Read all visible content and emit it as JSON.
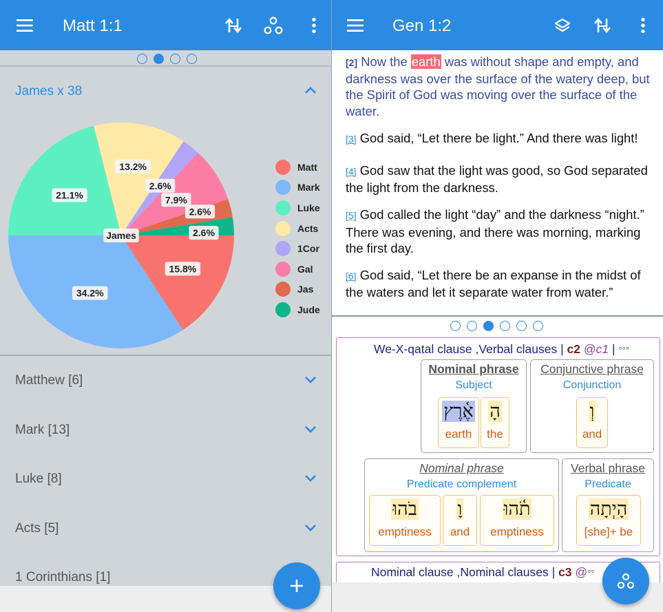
{
  "left": {
    "title": "Matt 1:1",
    "pager_dots": 4,
    "pager_active": 1,
    "card_heading": "James x 38",
    "center_label": "James",
    "books": [
      {
        "label": "Matthew [6]"
      },
      {
        "label": "Mark [13]"
      },
      {
        "label": "Luke [8]"
      },
      {
        "label": "Acts [5]"
      },
      {
        "label": "1 Corinthians [1]"
      }
    ]
  },
  "chart_data": {
    "type": "pie",
    "title": "",
    "center_label": "James",
    "categories": [
      "Matt",
      "Mark",
      "Luke",
      "Acts",
      "1Cor",
      "Gal",
      "Jas",
      "Jude"
    ],
    "values": [
      15.8,
      34.2,
      21.1,
      13.2,
      2.6,
      7.9,
      2.6,
      2.6
    ],
    "labels": [
      "15.8%",
      "34.2%",
      "21.1%",
      "13.2%",
      "2.6%",
      "7.9%",
      "2.6%",
      "2.6%"
    ],
    "colors": [
      "#f8736e",
      "#7db8fa",
      "#5cf0c0",
      "#ffe9a6",
      "#b1a5f9",
      "#fb7da5",
      "#e16a4e",
      "#11b58c"
    ],
    "legend_position": "right"
  },
  "right": {
    "title": "Gen 1:2",
    "pager_dots": 6,
    "pager_active": 2,
    "verses": [
      {
        "num": "[2]",
        "before": "Now the ",
        "highlight": "earth",
        "after": " was without shape and empty, and darkness was over the surface of the watery deep, but the Spirit of God was moving over the surface of the water."
      },
      {
        "num": "[3]",
        "text": "God said, “Let there be light.” And there was light!"
      },
      {
        "num": "[4]",
        "text": "God saw that the light was good, so God separated the light from the darkness."
      },
      {
        "num": "[5]",
        "text": "God called the light “day” and the darkness “night.” There was evening, and there was morning, marking the first day."
      },
      {
        "num": "[6]",
        "text": "God said, “Let there be an expanse in the midst of the waters and let it separate water from water.”"
      }
    ],
    "clause1": {
      "name": "We-X-qatal clause ,Verbal clauses",
      "sep": " | ",
      "code": "c2",
      "at": "@",
      "ref": "c1",
      "sep2": " | ",
      "more": "°°°",
      "phrases": [
        {
          "name": "Nominal phrase",
          "func": "Subject",
          "words": [
            {
              "heb": "אֶ֫רֶץ",
              "gloss": "earth"
            },
            {
              "heb": "הָ",
              "gloss": "the"
            }
          ]
        },
        {
          "name": "Conjunctive phrase",
          "func": "Conjunction",
          "words": [
            {
              "heb": "וְ",
              "gloss": "and"
            }
          ]
        },
        {
          "name": "Nominal phrase",
          "func": "Predicate complement",
          "words": [
            {
              "heb": "בֹהוּ",
              "gloss": "emptiness"
            },
            {
              "heb": "וָ",
              "gloss": "and"
            },
            {
              "heb": "תֹ֫הוּ",
              "gloss": "emptiness"
            }
          ]
        },
        {
          "name": "Verbal phrase",
          "func": "Predicate",
          "words": [
            {
              "heb": "הָיְתָה",
              "gloss": "[she]+ be"
            }
          ]
        }
      ]
    },
    "clause2": {
      "name": "Nominal clause ,Nominal clauses",
      "sep": " | ",
      "code": "c3",
      "at": "@",
      "more": "°°"
    }
  },
  "colors": {
    "appbar": "#2b8be3",
    "accent": "#2b8be3",
    "left_background": "#d0d5d9",
    "highlight": "#f36b72",
    "clause_border": "#b77cc4",
    "gloss": "#d45b14"
  },
  "icons": {
    "menu": "hamburger-menu-icon",
    "sync": "sync-arrows-icon",
    "layers": "layers-icon",
    "share": "share-nodes-icon",
    "more": "more-vertical-icon",
    "chevron_up": "chevron-up-icon",
    "chevron_down": "chevron-down-icon",
    "add": "plus-icon"
  }
}
